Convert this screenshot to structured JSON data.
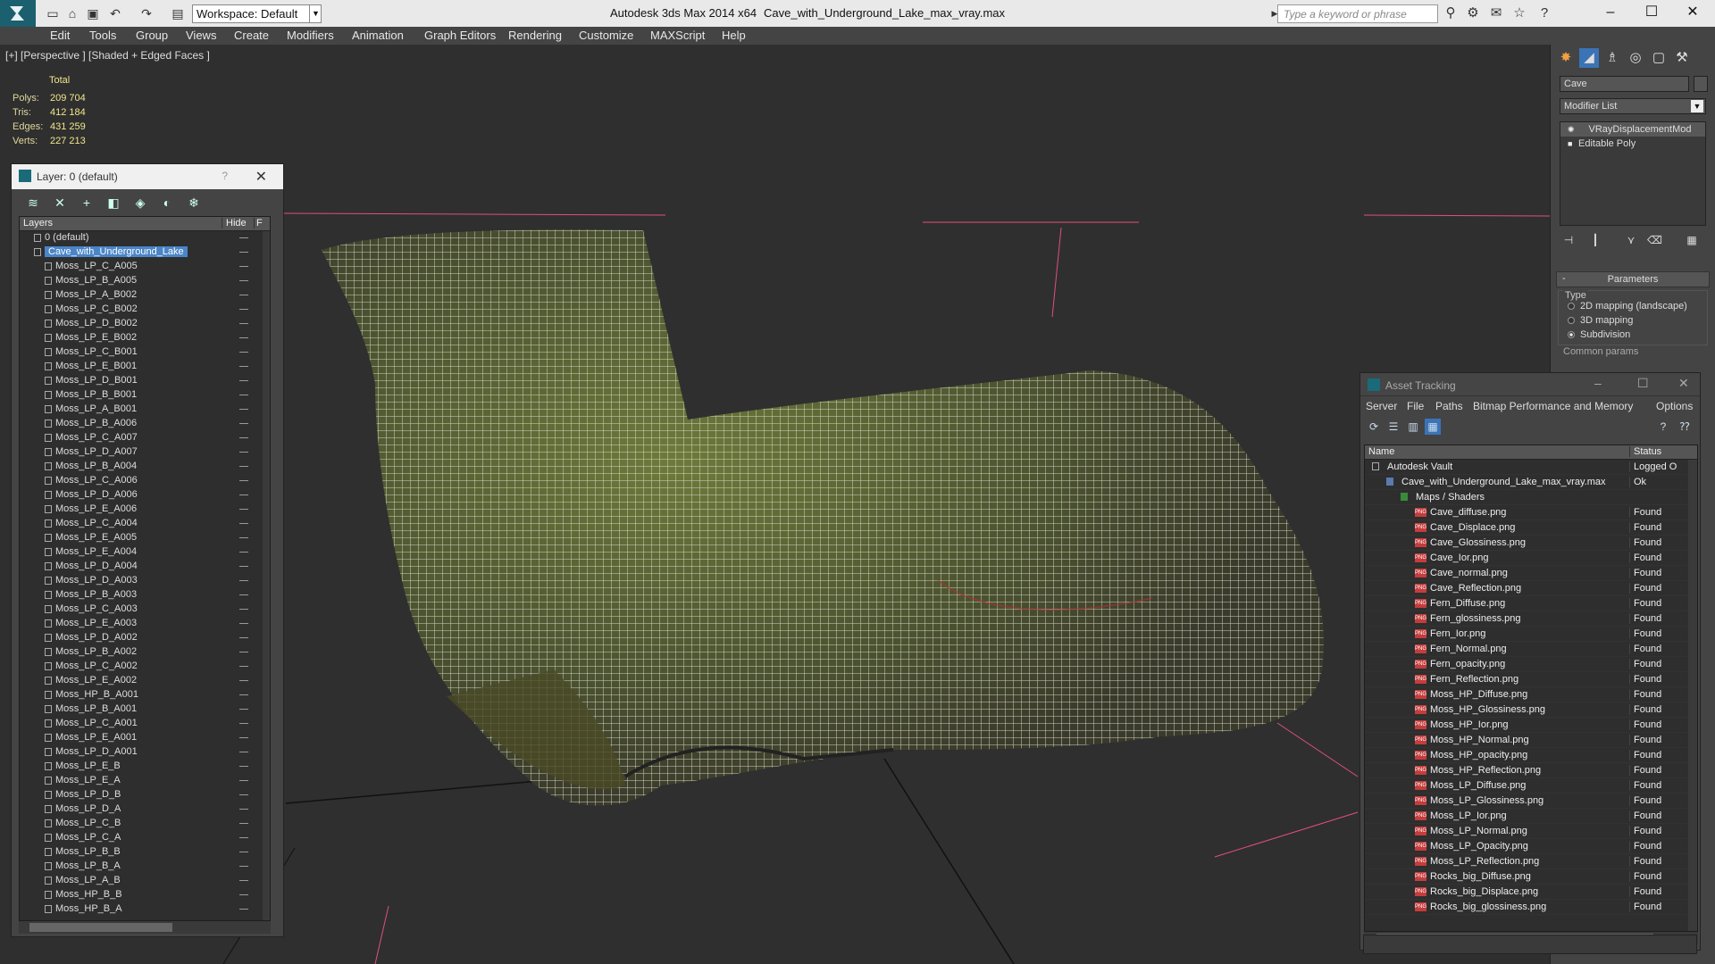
{
  "window": {
    "app_title": "Autodesk 3ds Max  2014 x64",
    "file_title": "Cave_with_Underground_Lake_max_vray.max",
    "workspace": "Workspace: Default",
    "search_placeholder": "Type a keyword or phrase"
  },
  "menu": [
    "Edit",
    "Tools",
    "Group",
    "Views",
    "Create",
    "Modifiers",
    "Animation",
    "Graph Editors",
    "Rendering",
    "Customize",
    "MAXScript",
    "Help"
  ],
  "viewport": {
    "label": "[+] [Perspective ] [Shaded + Edged Faces ]",
    "stats_header": "Total",
    "stats": [
      {
        "label": "Polys:",
        "value": "209 704"
      },
      {
        "label": "Tris:",
        "value": "412 184"
      },
      {
        "label": "Edges:",
        "value": "431 259"
      },
      {
        "label": "Verts:",
        "value": "227 213"
      }
    ]
  },
  "layer_panel": {
    "title": "Layer: 0 (default)",
    "help": "?",
    "col_layers": "Layers",
    "col_hide": "Hide",
    "col_freeze": "F",
    "layers": [
      {
        "name": "0 (default)",
        "level": 0,
        "kind": "layer"
      },
      {
        "name": "Cave_with_Underground_Lake",
        "level": 0,
        "kind": "layer",
        "selected": true
      },
      {
        "name": "Moss_LP_C_A005",
        "level": 1
      },
      {
        "name": "Moss_LP_B_A005",
        "level": 1
      },
      {
        "name": "Moss_LP_A_B002",
        "level": 1
      },
      {
        "name": "Moss_LP_C_B002",
        "level": 1
      },
      {
        "name": "Moss_LP_D_B002",
        "level": 1
      },
      {
        "name": "Moss_LP_E_B002",
        "level": 1
      },
      {
        "name": "Moss_LP_C_B001",
        "level": 1
      },
      {
        "name": "Moss_LP_E_B001",
        "level": 1
      },
      {
        "name": "Moss_LP_D_B001",
        "level": 1
      },
      {
        "name": "Moss_LP_B_B001",
        "level": 1
      },
      {
        "name": "Moss_LP_A_B001",
        "level": 1
      },
      {
        "name": "Moss_LP_B_A006",
        "level": 1
      },
      {
        "name": "Moss_LP_C_A007",
        "level": 1
      },
      {
        "name": "Moss_LP_D_A007",
        "level": 1
      },
      {
        "name": "Moss_LP_B_A004",
        "level": 1
      },
      {
        "name": "Moss_LP_C_A006",
        "level": 1
      },
      {
        "name": "Moss_LP_D_A006",
        "level": 1
      },
      {
        "name": "Moss_LP_E_A006",
        "level": 1
      },
      {
        "name": "Moss_LP_C_A004",
        "level": 1
      },
      {
        "name": "Moss_LP_E_A005",
        "level": 1
      },
      {
        "name": "Moss_LP_E_A004",
        "level": 1
      },
      {
        "name": "Moss_LP_D_A004",
        "level": 1
      },
      {
        "name": "Moss_LP_D_A003",
        "level": 1
      },
      {
        "name": "Moss_LP_B_A003",
        "level": 1
      },
      {
        "name": "Moss_LP_C_A003",
        "level": 1
      },
      {
        "name": "Moss_LP_E_A003",
        "level": 1
      },
      {
        "name": "Moss_LP_D_A002",
        "level": 1
      },
      {
        "name": "Moss_LP_B_A002",
        "level": 1
      },
      {
        "name": "Moss_LP_C_A002",
        "level": 1
      },
      {
        "name": "Moss_LP_E_A002",
        "level": 1
      },
      {
        "name": "Moss_HP_B_A001",
        "level": 1
      },
      {
        "name": "Moss_LP_B_A001",
        "level": 1
      },
      {
        "name": "Moss_LP_C_A001",
        "level": 1
      },
      {
        "name": "Moss_LP_E_A001",
        "level": 1
      },
      {
        "name": "Moss_LP_D_A001",
        "level": 1
      },
      {
        "name": "Moss_LP_E_B",
        "level": 1
      },
      {
        "name": "Moss_LP_E_A",
        "level": 1
      },
      {
        "name": "Moss_LP_D_B",
        "level": 1
      },
      {
        "name": "Moss_LP_D_A",
        "level": 1
      },
      {
        "name": "Moss_LP_C_B",
        "level": 1
      },
      {
        "name": "Moss_LP_C_A",
        "level": 1
      },
      {
        "name": "Moss_LP_B_B",
        "level": 1
      },
      {
        "name": "Moss_LP_B_A",
        "level": 1
      },
      {
        "name": "Moss_LP_A_B",
        "level": 1
      },
      {
        "name": "Moss_HP_B_B",
        "level": 1
      },
      {
        "name": "Moss_HP_B_A",
        "level": 1
      }
    ]
  },
  "command_panel": {
    "object_name": "Cave",
    "modifier_list": "Modifier List",
    "stack": [
      "VRayDisplacementMod",
      "Editable Poly"
    ],
    "rollout": "Parameters",
    "rollout_toggle": "-",
    "type_label": "Type",
    "type_options": [
      {
        "label": "2D mapping (landscape)",
        "checked": false
      },
      {
        "label": "3D mapping",
        "checked": false
      },
      {
        "label": "Subdivision",
        "checked": true
      }
    ],
    "common_params": "Common params"
  },
  "asset_panel": {
    "title": "Asset Tracking",
    "menu": [
      "Server",
      "File",
      "Paths",
      "Bitmap Performance and Memory",
      "Options"
    ],
    "col_name": "Name",
    "col_status": "Status",
    "rows": [
      {
        "name": "Autodesk Vault",
        "status": "Logged O",
        "level": 0,
        "kind": "vault"
      },
      {
        "name": "Cave_with_Underground_Lake_max_vray.max",
        "status": "Ok",
        "level": 1,
        "kind": "file"
      },
      {
        "name": "Maps / Shaders",
        "status": "",
        "level": 2,
        "kind": "folder"
      },
      {
        "name": "Cave_diffuse.png",
        "status": "Found",
        "level": 3,
        "kind": "png"
      },
      {
        "name": "Cave_Displace.png",
        "status": "Found",
        "level": 3,
        "kind": "png"
      },
      {
        "name": "Cave_Glossiness.png",
        "status": "Found",
        "level": 3,
        "kind": "png"
      },
      {
        "name": "Cave_Ior.png",
        "status": "Found",
        "level": 3,
        "kind": "png"
      },
      {
        "name": "Cave_normal.png",
        "status": "Found",
        "level": 3,
        "kind": "png"
      },
      {
        "name": "Cave_Reflection.png",
        "status": "Found",
        "level": 3,
        "kind": "png"
      },
      {
        "name": "Fern_Diffuse.png",
        "status": "Found",
        "level": 3,
        "kind": "png"
      },
      {
        "name": "Fern_glossiness.png",
        "status": "Found",
        "level": 3,
        "kind": "png"
      },
      {
        "name": "Fern_Ior.png",
        "status": "Found",
        "level": 3,
        "kind": "png"
      },
      {
        "name": "Fern_Normal.png",
        "status": "Found",
        "level": 3,
        "kind": "png"
      },
      {
        "name": "Fern_opacity.png",
        "status": "Found",
        "level": 3,
        "kind": "png"
      },
      {
        "name": "Fern_Reflection.png",
        "status": "Found",
        "level": 3,
        "kind": "png"
      },
      {
        "name": "Moss_HP_Diffuse.png",
        "status": "Found",
        "level": 3,
        "kind": "png"
      },
      {
        "name": "Moss_HP_Glossiness.png",
        "status": "Found",
        "level": 3,
        "kind": "png"
      },
      {
        "name": "Moss_HP_Ior.png",
        "status": "Found",
        "level": 3,
        "kind": "png"
      },
      {
        "name": "Moss_HP_Normal.png",
        "status": "Found",
        "level": 3,
        "kind": "png"
      },
      {
        "name": "Moss_HP_opacity.png",
        "status": "Found",
        "level": 3,
        "kind": "png"
      },
      {
        "name": "Moss_HP_Reflection.png",
        "status": "Found",
        "level": 3,
        "kind": "png"
      },
      {
        "name": "Moss_LP_Diffuse.png",
        "status": "Found",
        "level": 3,
        "kind": "png"
      },
      {
        "name": "Moss_LP_Glossiness.png",
        "status": "Found",
        "level": 3,
        "kind": "png"
      },
      {
        "name": "Moss_LP_Ior.png",
        "status": "Found",
        "level": 3,
        "kind": "png"
      },
      {
        "name": "Moss_LP_Normal.png",
        "status": "Found",
        "level": 3,
        "kind": "png"
      },
      {
        "name": "Moss_LP_Opacity.png",
        "status": "Found",
        "level": 3,
        "kind": "png"
      },
      {
        "name": "Moss_LP_Reflection.png",
        "status": "Found",
        "level": 3,
        "kind": "png"
      },
      {
        "name": "Rocks_big_Diffuse.png",
        "status": "Found",
        "level": 3,
        "kind": "png"
      },
      {
        "name": "Rocks_big_Displace.png",
        "status": "Found",
        "level": 3,
        "kind": "png"
      },
      {
        "name": "Rocks_big_glossiness.png",
        "status": "Found",
        "level": 3,
        "kind": "png"
      }
    ]
  },
  "colors": {
    "selection": "#4a85c8",
    "stats_text": "#f0e68c",
    "wire": "#ffffff",
    "moss": "#5a6a2a",
    "grid_marker": "#e0507a"
  }
}
